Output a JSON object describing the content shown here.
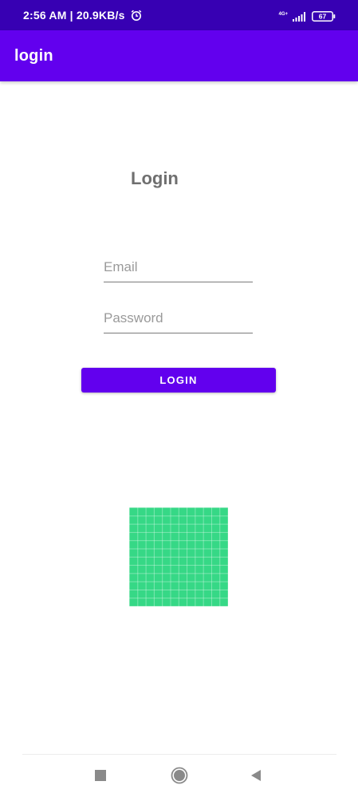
{
  "status_bar": {
    "time_speed": "2:56 AM | 20.9KB/s",
    "network_type": "4G+",
    "battery": "67",
    "alarm_icon": "alarm-clock-icon",
    "signal_icon": "signal-icon",
    "battery_icon": "battery-icon"
  },
  "app_bar": {
    "title": "login",
    "color": "#6200ee"
  },
  "form": {
    "heading": "Login",
    "email_placeholder": "Email",
    "email_value": "",
    "password_placeholder": "Password",
    "password_value": "",
    "button_label": "LOGIN",
    "button_color": "#6200ee"
  },
  "image": {
    "color": "#36d886"
  },
  "navigation": {
    "recents_icon": "square-icon",
    "home_icon": "circle-icon",
    "back_icon": "triangle-back-icon"
  }
}
